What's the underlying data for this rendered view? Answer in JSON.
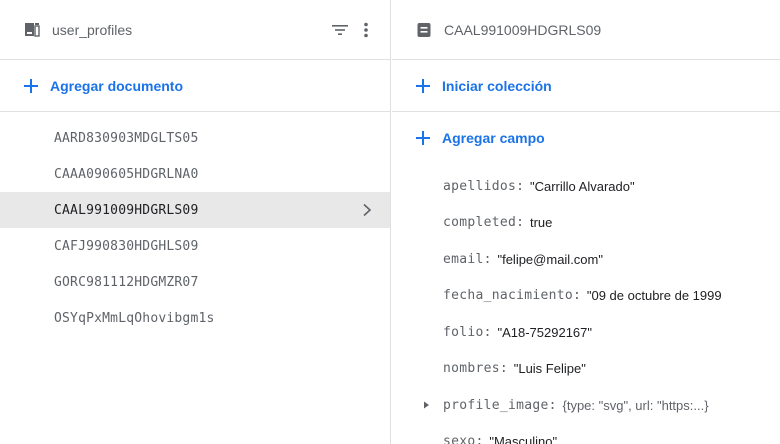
{
  "collection_panel": {
    "title": "user_profiles",
    "add_document_label": "Agregar documento",
    "documents": [
      {
        "id": "AARD830903MDGLTS05",
        "selected": false
      },
      {
        "id": "CAAA090605HDGRLNA0",
        "selected": false
      },
      {
        "id": "CAAL991009HDGRLS09",
        "selected": true
      },
      {
        "id": "CAFJ990830HDGHLS09",
        "selected": false
      },
      {
        "id": "GORC981112HDGMZR07",
        "selected": false
      },
      {
        "id": "OSYqPxMmLqOhovibgm1s",
        "selected": false
      }
    ]
  },
  "document_panel": {
    "title": "CAAL991009HDGRLS09",
    "start_collection_label": "Iniciar colección",
    "add_field_label": "Agregar campo",
    "fields": [
      {
        "key": "apellidos",
        "value": "\"Carrillo Alvarado\""
      },
      {
        "key": "completed",
        "value": "true"
      },
      {
        "key": "email",
        "value": "\"felipe@mail.com\""
      },
      {
        "key": "fecha_nacimiento",
        "value": "\"09 de octubre de 1999"
      },
      {
        "key": "folio",
        "value": "\"A18-75292167\""
      },
      {
        "key": "nombres",
        "value": "\"Luis Felipe\""
      },
      {
        "key": "profile_image",
        "value": "{type: \"svg\", url: \"https:...}"
      },
      {
        "key": "sexo",
        "value": "\"Masculino\""
      }
    ]
  },
  "colors": {
    "accent": "#1a73e8",
    "selected_bg": "#e8e8e8",
    "muted_text": "#5f6368",
    "divider": "#e0e0e0"
  }
}
